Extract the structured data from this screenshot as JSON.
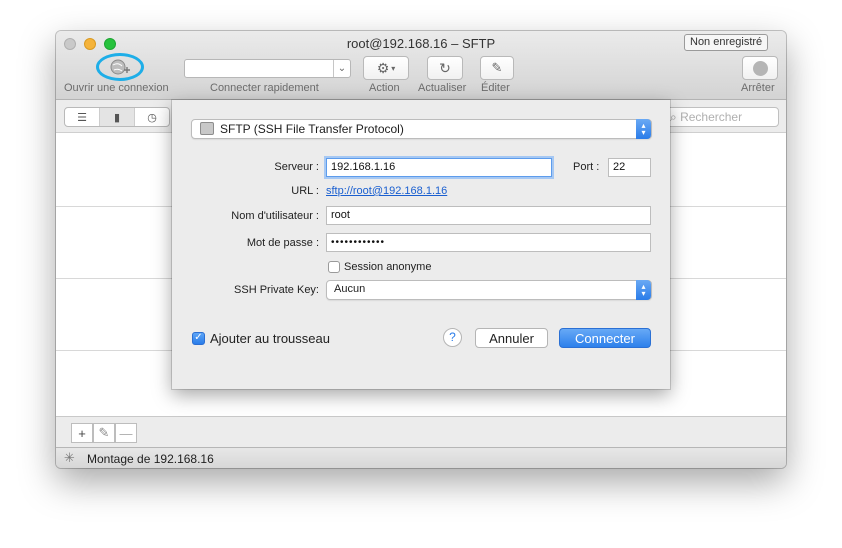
{
  "window": {
    "title": "root@192.168.16 – SFTP",
    "badge": "Non enregistré"
  },
  "toolbar": {
    "open_connection_label": "Ouvrir une connexion",
    "quick_connect_label": "Connecter rapidement",
    "quick_connect_value": "",
    "action_label": "Action",
    "refresh_label": "Actualiser",
    "edit_label": "Éditer",
    "stop_label": "Arrêter"
  },
  "search": {
    "placeholder": "Rechercher"
  },
  "status": {
    "text": "Montage de 192.168.16"
  },
  "dialog": {
    "protocol": "SFTP (SSH File Transfer Protocol)",
    "server_label": "Serveur :",
    "server_value": "192.168.1.16",
    "port_label": "Port :",
    "port_value": "22",
    "url_label": "URL :",
    "url_value": "sftp://root@192.168.1.16",
    "username_label": "Nom d'utilisateur :",
    "username_value": "root",
    "password_label": "Mot de passe :",
    "password_value": "••••••••••••",
    "anonymous_label": "Session anonyme",
    "private_key_label": "SSH Private Key:",
    "private_key_value": "Aucun",
    "keychain_label": "Ajouter au trousseau",
    "help_label": "?",
    "cancel_label": "Annuler",
    "connect_label": "Connecter"
  },
  "bottom": {
    "add_label": "+",
    "remove_label": "—"
  },
  "colors": {
    "accent": "#2a7ce9",
    "highlight_ring": "#1eaee8",
    "close": "#c9c9c9",
    "minimize": "#f5b33a",
    "zoom": "#27c23d"
  }
}
